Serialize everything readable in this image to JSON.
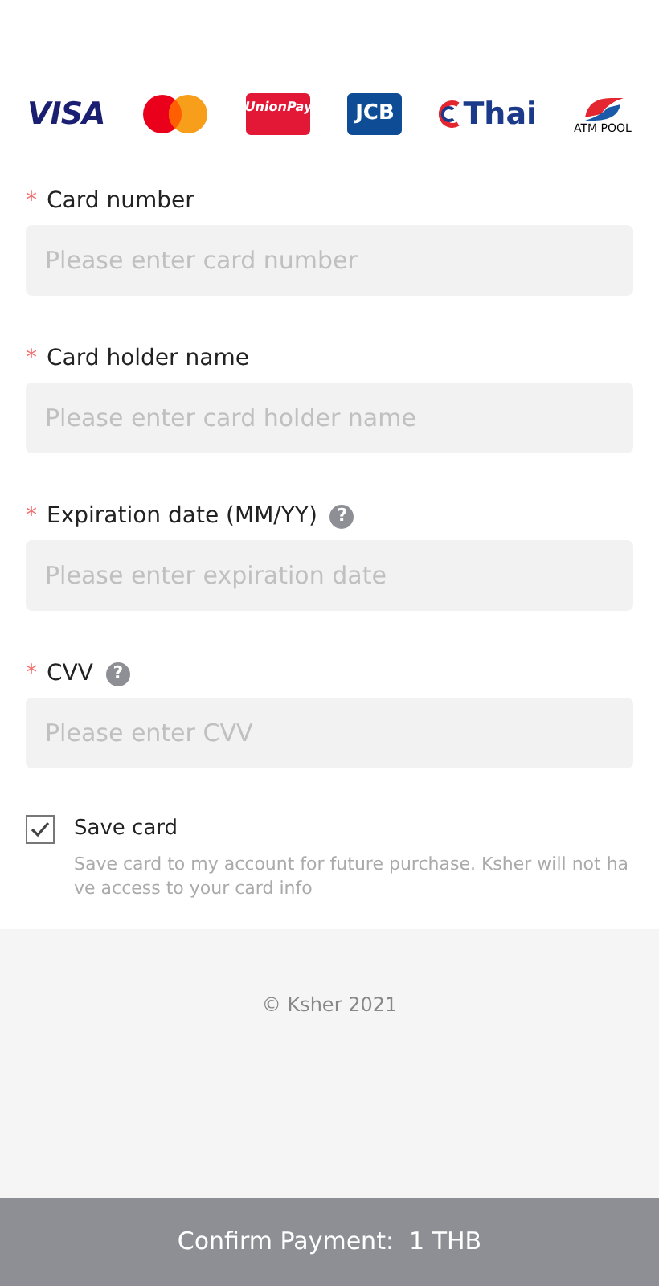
{
  "card_brands": [
    {
      "kind": "visa",
      "text": "VISA"
    },
    {
      "kind": "mastercard"
    },
    {
      "kind": "unionpay",
      "text": "UnionPay"
    },
    {
      "kind": "jcb",
      "text": "JCB"
    },
    {
      "kind": "thai",
      "text": "Thai"
    },
    {
      "kind": "atmpool",
      "text": "ATM POOL"
    }
  ],
  "fields": [
    {
      "required_mark": "*",
      "label": "Card number",
      "placeholder": "Please enter card number"
    },
    {
      "required_mark": "*",
      "label": "Card holder name",
      "placeholder": "Please enter card holder name"
    },
    {
      "required_mark": "*",
      "label": "Expiration date (MM/YY)",
      "help": "?",
      "placeholder": "Please enter expiration date"
    },
    {
      "required_mark": "*",
      "label": "CVV",
      "help": "?",
      "placeholder": "Please enter CVV"
    }
  ],
  "save_card": {
    "label": "Save card",
    "checked": true,
    "description": "Save card to my account for future purchase. Ksher will not have access to your card info"
  },
  "footer": {
    "copyright": "© Ksher 2021"
  },
  "confirm_button": {
    "label": "Confirm Payment:  1 THB"
  }
}
